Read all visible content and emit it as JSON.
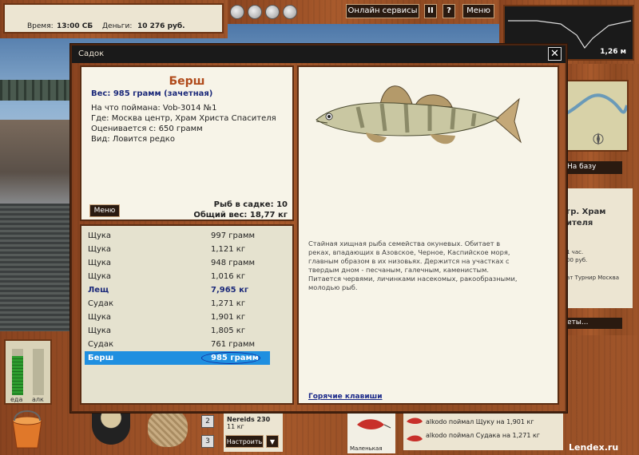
{
  "status": {
    "time_label": "Время:",
    "time_value": "13:00 СБ",
    "money_label": "Деньги:",
    "money_value": "10 276 руб."
  },
  "top_buttons": {
    "online_services": "Онлайн сервисы",
    "pause": "II",
    "help": "?",
    "menu": "Меню"
  },
  "depth": {
    "value": "1,26 м"
  },
  "right_panel": {
    "to_base": "На базу",
    "place_title_1": "гр. Храм",
    "place_title_2": "ителя",
    "info_1": "1 час.",
    "info_2": "00 руб.",
    "info_3": "ат Турнир Москва",
    "chat_label": "еты..."
  },
  "meters": {
    "food_label": "еда",
    "alcohol_label": "алк",
    "food_level": 0.85,
    "alcohol_level": 0
  },
  "bottom": {
    "slot_1": "2",
    "slot_2": "3",
    "tackle_name": "Nereids 230",
    "tackle_weight": "11 кг",
    "tune_button": "Настроить",
    "tune_arrow": "▼",
    "lure_label": "Маленькая",
    "log": [
      "alkodo поймал Щуку на 1,901 кг",
      "alkodo поймал Судака на 1,271 кг"
    ],
    "watermark": "Lendex.ru"
  },
  "dialog": {
    "title": "Садок",
    "close": "✕",
    "fish": {
      "name": "Берш",
      "weight": "Вес: 985 грамм (зачетная)",
      "caught_with": "На что поймана: Vob-3014 №1",
      "location": "Где: Москва центр, Храм Христа Спасителя",
      "value": "Оценивается с: 650 грамм",
      "rarity": "Вид: Ловится редко"
    },
    "menu_button": "Меню",
    "cage_count": "Рыб в садке: 10",
    "cage_weight": "Общий вес: 18,77 кг",
    "catch_list": [
      {
        "name": "Щука",
        "weight": "997 грамм"
      },
      {
        "name": "Щука",
        "weight": "1,121 кг"
      },
      {
        "name": "Щука",
        "weight": "948 грамм"
      },
      {
        "name": "Щука",
        "weight": "1,016 кг"
      },
      {
        "name": "Лещ",
        "weight": "7,965 кг"
      },
      {
        "name": "Судак",
        "weight": "1,271 кг"
      },
      {
        "name": "Щука",
        "weight": "1,901 кг"
      },
      {
        "name": "Щука",
        "weight": "1,805 кг"
      },
      {
        "name": "Судак",
        "weight": "761 грамм"
      },
      {
        "name": "Берш",
        "weight": "985 грамм"
      }
    ],
    "description": "Стайная хищная рыба семейства окуневых. Обитает в реках, впадающих в Азовское, Черное, Каспийское моря, главным образом в их низовьях. Держится на участках с твердым дном - песчаным, галечным, каменистым. Питается червями, личинками насекомых, ракообразными, молодью рыб.",
    "hotkeys": "Горячие клавиши"
  }
}
